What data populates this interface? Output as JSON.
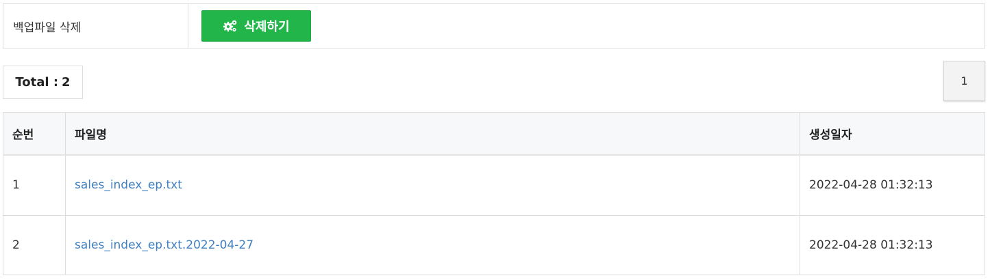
{
  "backup_delete": {
    "label": "백업파일 삭제",
    "button_label": "삭제하기",
    "button_icon": "gears-icon",
    "button_color": "#22b64a"
  },
  "summary": {
    "total_label": "Total :",
    "total_count": "2"
  },
  "pagination": {
    "current_page": "1"
  },
  "table": {
    "headers": {
      "no": "순번",
      "filename": "파일명",
      "created": "생성일자"
    },
    "rows": [
      {
        "no": "1",
        "filename": "sales_index_ep.txt",
        "created": "2022-04-28 01:32:13"
      },
      {
        "no": "2",
        "filename": "sales_index_ep.txt.2022-04-27",
        "created": "2022-04-28 01:32:13"
      }
    ],
    "link_color": "#3f7fc0"
  }
}
